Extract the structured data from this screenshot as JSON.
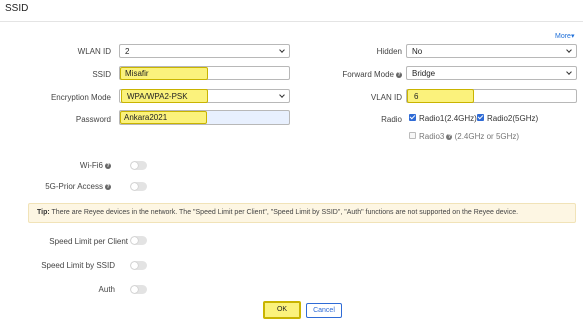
{
  "header": {
    "title": "SSID"
  },
  "more_link": "More▾",
  "left": {
    "wlan_id": {
      "label": "WLAN ID",
      "value": "2"
    },
    "ssid": {
      "label": "SSID",
      "value": "Misafir"
    },
    "encryption": {
      "label": "Encryption Mode",
      "value": "WPA/WPA2-PSK"
    },
    "password": {
      "label": "Password",
      "value": "Ankara2021"
    }
  },
  "right": {
    "hidden": {
      "label": "Hidden",
      "value": "No"
    },
    "forward_mode": {
      "label": "Forward Mode",
      "value": "Bridge"
    },
    "vlan_id": {
      "label": "VLAN ID",
      "value": "6"
    },
    "radio": {
      "label": "Radio",
      "radio1": {
        "label": "Radio1(2.4GHz)",
        "checked": true
      },
      "radio2": {
        "label": "Radio2(5GHz)",
        "checked": true
      },
      "radio3": {
        "label": "Radio3",
        "note": "(2.4GHz or 5GHz)",
        "checked": false
      }
    }
  },
  "toggles": {
    "wifi6": {
      "label": "Wi-Fi6",
      "on": false
    },
    "prior_access": {
      "label": "5G-Prior Access",
      "on": false
    },
    "speed_limit_client": {
      "label": "Speed Limit per Client",
      "on": false
    },
    "speed_limit_ssid": {
      "label": "Speed Limit by SSID",
      "on": false
    },
    "auth": {
      "label": "Auth",
      "on": false
    }
  },
  "tip": {
    "prefix": "Tip:",
    "text": "There are Reyee devices in the network. The \"Speed Limit per Client\", \"Speed Limit by SSID\", \"Auth\" functions are not supported on the Reyee device."
  },
  "buttons": {
    "ok": "OK",
    "cancel": "Cancel"
  },
  "colors": {
    "highlight": "#fbf27c",
    "accent": "#2f6bd6",
    "tip_bg": "#fdf6e3"
  }
}
